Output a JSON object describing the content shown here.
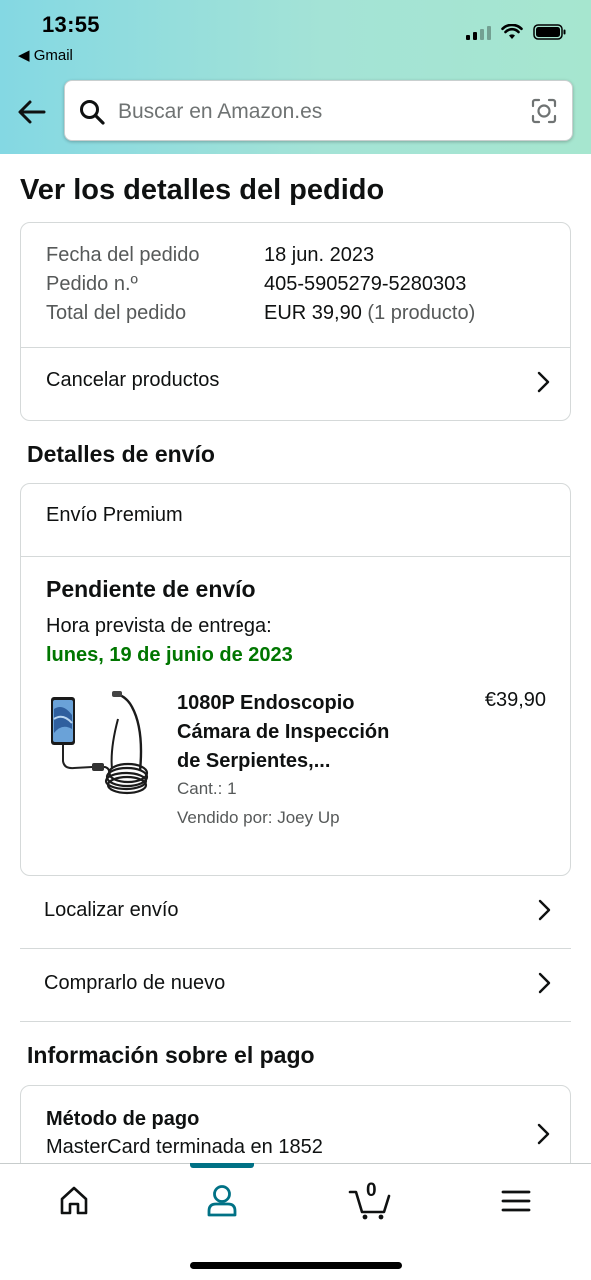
{
  "status_bar": {
    "time": "13:55",
    "back_app": "◀ Gmail"
  },
  "search": {
    "placeholder": "Buscar en Amazon.es"
  },
  "page_title": "Ver los detalles del pedido",
  "summary": {
    "date_label": "Fecha del pedido",
    "date_value": "18 jun. 2023",
    "order_label": "Pedido n.º",
    "order_value": "405-5905279-5280303",
    "total_label": "Total del pedido",
    "total_value": "EUR 39,90",
    "total_count": "(1 producto)",
    "cancel_link": "Cancelar productos"
  },
  "shipping": {
    "section_title": "Detalles de envío",
    "type": "Envío Premium",
    "status": "Pendiente de envío",
    "eta_label": "Hora prevista de entrega:",
    "eta_date": "lunes, 19 de junio de 2023",
    "product": {
      "title_line1": "1080P Endoscopio",
      "title_line2": "Cámara de Inspección",
      "title_line3": "de Serpientes,...",
      "price": "€39,90",
      "qty": "Cant.: 1",
      "seller": "Vendido por: Joey Up"
    },
    "track": "Localizar envío",
    "buy_again": "Comprarlo de nuevo"
  },
  "payment": {
    "section_title": "Información sobre el pago",
    "method_label": "Método de pago",
    "method_value": "MasterCard terminada en 1852"
  },
  "bottom_nav": {
    "cart_count": "0"
  },
  "colors": {
    "accent": "#007185",
    "green": "#007600",
    "text": "#0f1111",
    "muted": "#565959"
  },
  "icons": [
    "back-arrow-icon",
    "search-icon",
    "camera-icon",
    "chevron-right-icon",
    "home-icon",
    "account-icon",
    "cart-icon",
    "menu-icon"
  ]
}
